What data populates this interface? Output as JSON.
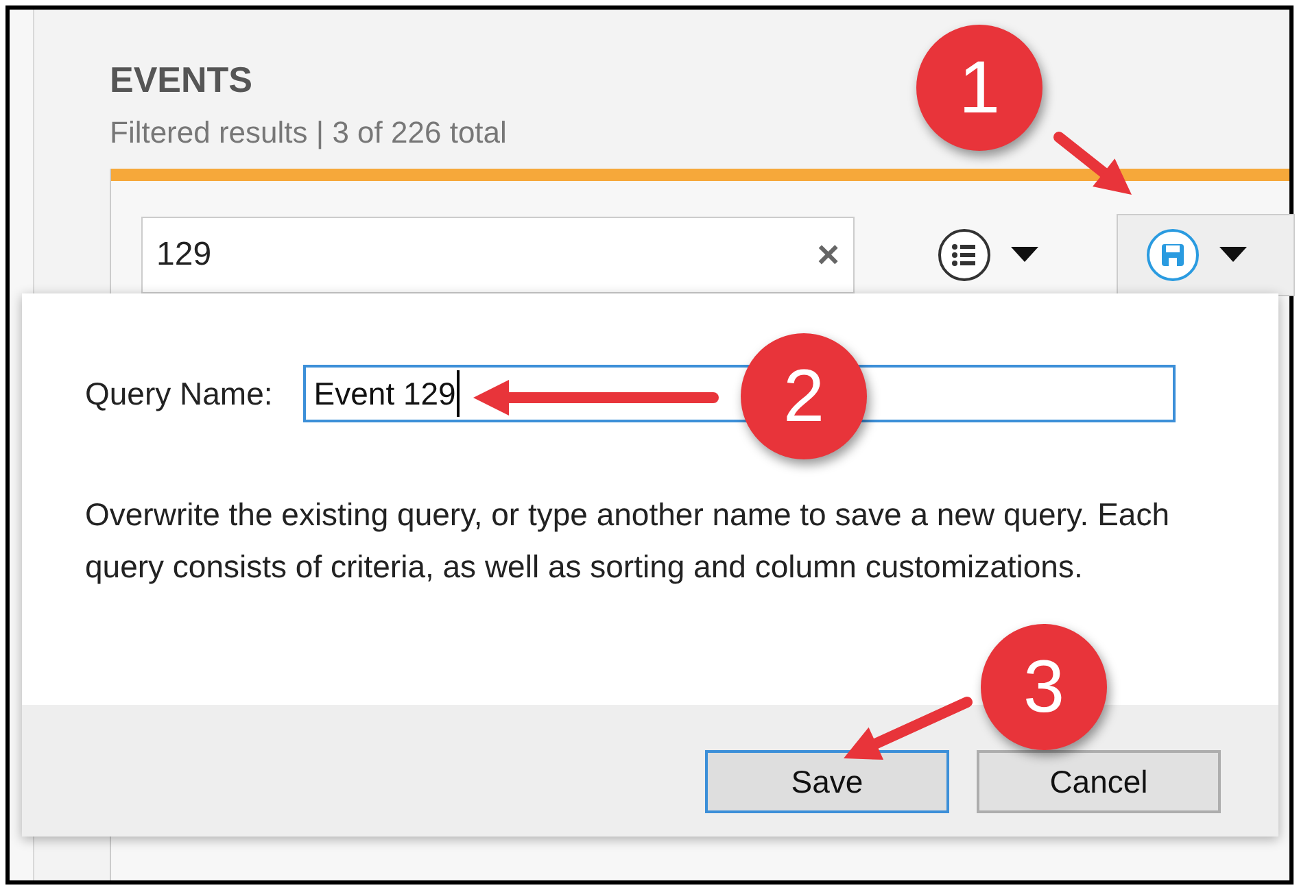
{
  "header": {
    "title": "EVENTS",
    "subtitle": "Filtered results | 3 of 226 total"
  },
  "toolbar": {
    "search": {
      "value": "129",
      "clear": "×"
    }
  },
  "dialog": {
    "field_label": "Query Name:",
    "field_value": "Event 129",
    "description": "Overwrite the existing query, or type another name to save a new query. Each query consists of criteria, as well as sorting and column customizations.",
    "buttons": [
      {
        "label": "Save",
        "kind": "primary"
      },
      {
        "label": "Cancel",
        "kind": "secondary"
      }
    ]
  },
  "callouts": [
    {
      "label": "1"
    },
    {
      "label": "2"
    },
    {
      "label": "3"
    }
  ]
}
